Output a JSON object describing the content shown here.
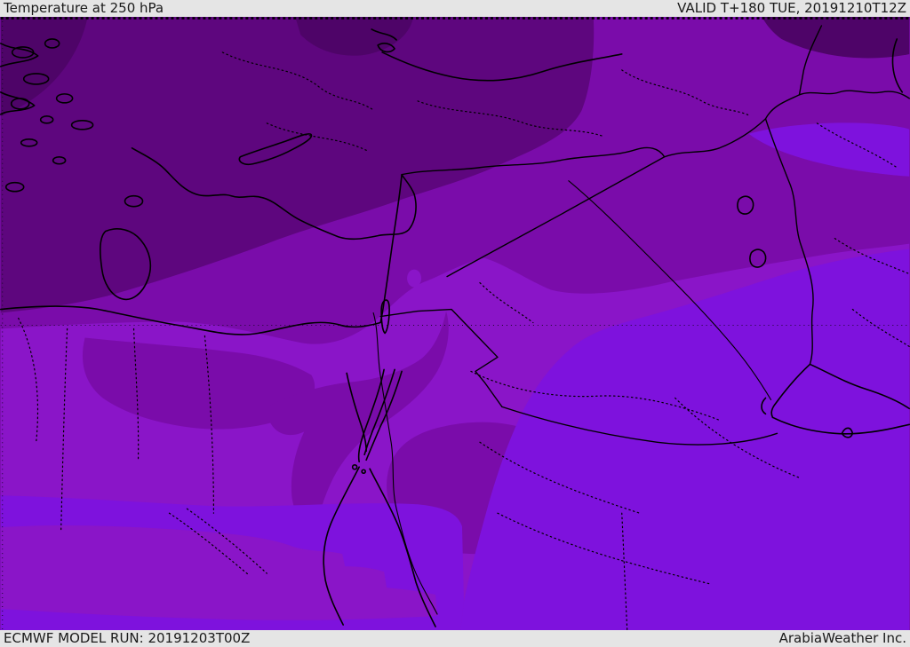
{
  "header": {
    "title": "Temperature at 250 hPa",
    "validity": "VALID T+180 TUE, 20191210T12Z"
  },
  "footer": {
    "model_run": "ECMWF MODEL RUN: 20191203T00Z",
    "provider": "ArabiaWeather Inc."
  },
  "map": {
    "bar_background": "#e5e5e5",
    "text_color": "#1a1a1a",
    "border_color": "#000000",
    "palette": {
      "c1": "#4e0468",
      "c2": "#5e067e",
      "c3": "#7a0caa",
      "c4": "#8a15c8",
      "c5": "#7e12dd"
    }
  }
}
